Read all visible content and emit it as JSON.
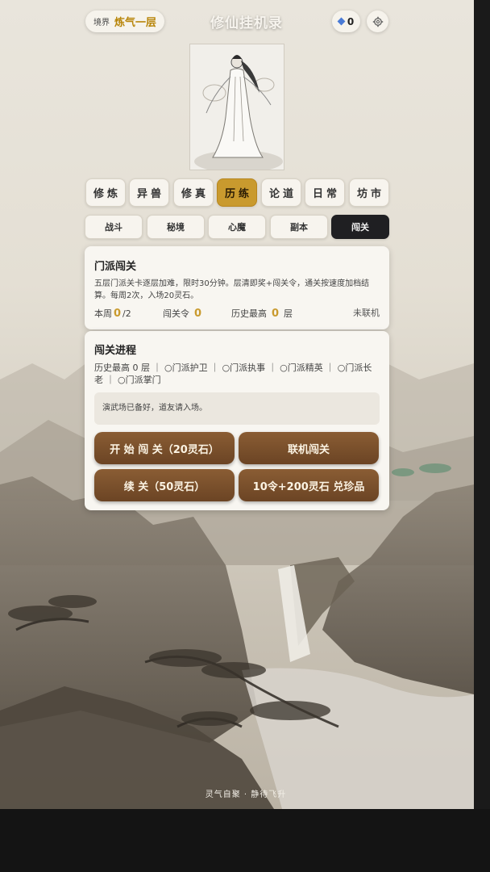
{
  "header": {
    "realm_label": "境界",
    "realm_value": "炼气一层",
    "app_title": "修仙挂机录",
    "stone_count": "0",
    "settings_icon": "gear-icon"
  },
  "main_tabs": [
    {
      "label": "修炼"
    },
    {
      "label": "异兽"
    },
    {
      "label": "修真"
    },
    {
      "label": "历练",
      "active": true
    },
    {
      "label": "论道"
    },
    {
      "label": "日常"
    },
    {
      "label": "坊市"
    }
  ],
  "sub_tabs": [
    {
      "label": "战斗"
    },
    {
      "label": "秘境"
    },
    {
      "label": "心魔"
    },
    {
      "label": "副本"
    },
    {
      "label": "闯关",
      "active": true
    }
  ],
  "sect_card": {
    "title": "门派闯关",
    "description": "五层门派关卡逐层加难，限时30分钟。层清即奖+闯关令，通关按速度加档结算。每周2次，入场20灵石。",
    "weekly_label": "本周",
    "weekly_used": "0",
    "weekly_total": "/2",
    "token_label": "闯关令",
    "token_value": "0",
    "best_label": "历史最高",
    "best_value": "0",
    "best_unit": "层",
    "status": "未联机"
  },
  "progress_card": {
    "title": "闯关进程",
    "progress_line": "历史最高 0 层 ｜ ○门派护卫 ｜ ○门派执事 ｜ ○门派精英 ｜ ○门派长老 ｜ ○门派掌门",
    "message": "演武场已备好，道友请入场。",
    "buttons": {
      "start": "开 始 闯 关（20灵石）",
      "online": "联机闯关",
      "continue": "续 关（50灵石）",
      "exchange": "10令+200灵石 兑珍品"
    }
  },
  "footer": "灵气自聚 · 静待飞升",
  "colors": {
    "accent_gold": "#c99a2e",
    "button_brown": "#7a5030",
    "active_subtab": "#1f1f22"
  }
}
